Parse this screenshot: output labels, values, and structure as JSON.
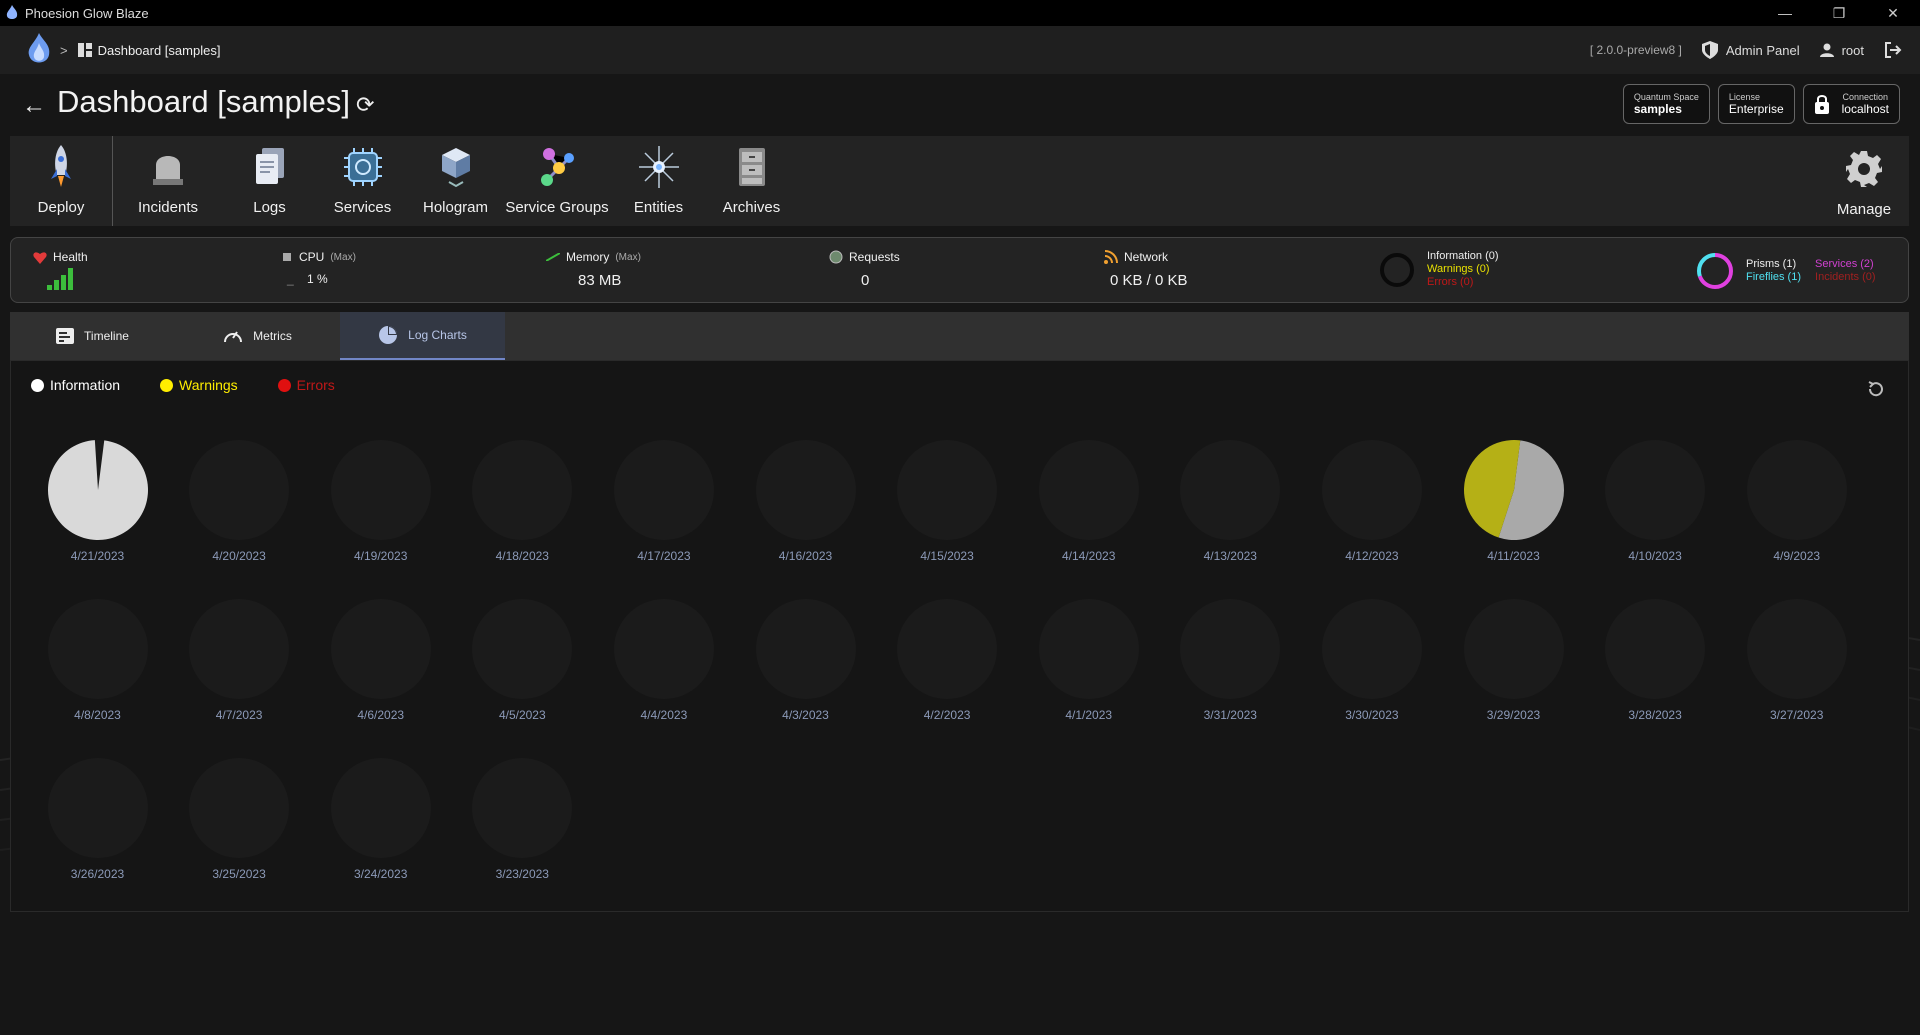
{
  "window": {
    "title": "Phoesion Glow Blaze",
    "minimize": "—",
    "restore": "❐",
    "close": "✕"
  },
  "navbar": {
    "crumb_sep": ">",
    "breadcrumb": "Dashboard [samples]",
    "version": "[ 2.0.0-preview8 ]",
    "admin_panel": "Admin Panel",
    "user": "root"
  },
  "page": {
    "title": "Dashboard [samples]",
    "back": "←",
    "refresh": "⟳",
    "chips": {
      "space_label": "Quantum Space",
      "space_value": "samples",
      "license_label": "License",
      "license_value": "Enterprise",
      "conn_label": "Connection",
      "conn_value": "localhost"
    }
  },
  "toolbar": {
    "items": [
      {
        "label": "Deploy",
        "icon": "rocket-icon"
      },
      {
        "label": "Incidents",
        "icon": "alarm-icon"
      },
      {
        "label": "Logs",
        "icon": "logs-icon"
      },
      {
        "label": "Services",
        "icon": "chip-icon"
      },
      {
        "label": "Hologram",
        "icon": "cube-icon"
      },
      {
        "label": "Service Groups",
        "icon": "molecule-icon"
      },
      {
        "label": "Entities",
        "icon": "star-icon"
      },
      {
        "label": "Archives",
        "icon": "cabinet-icon"
      }
    ],
    "manage": "Manage"
  },
  "status": {
    "health_label": "Health",
    "health_level": 1.0,
    "cpu_label": "CPU",
    "cpu_max": "(Max)",
    "cpu_value": "1 %",
    "cpu_dash": "_",
    "memory_label": "Memory",
    "memory_max": "(Max)",
    "memory_value": "83 MB",
    "requests_label": "Requests",
    "requests_value": "0",
    "network_label": "Network",
    "network_value": "0 KB / 0 KB",
    "logs": {
      "information": "Information (0)",
      "warnings": "Warnings (0)",
      "errors": "Errors (0)"
    },
    "entities": {
      "prisms": "Prisms (1)",
      "fireflies": "Fireflies (1)",
      "services": "Services (2)",
      "incidents": "Incidents (0)"
    }
  },
  "tabs": [
    {
      "label": "Timeline",
      "active": false
    },
    {
      "label": "Metrics",
      "active": false
    },
    {
      "label": "Log Charts",
      "active": true
    }
  ],
  "legend": {
    "information": "Information",
    "warnings": "Warnings",
    "errors": "Errors"
  },
  "colors": {
    "information": "#ffffff",
    "warnings": "#ffee00",
    "errors": "#e01010",
    "pie_info": "#d9d9d9",
    "pie_info_2": "#a9a9a9",
    "pie_warn": "#b5b016",
    "pie_empty": "#1b1b1b"
  },
  "chart_data": {
    "type": "pie",
    "series_keys": [
      "information",
      "warnings",
      "errors"
    ],
    "charts": [
      {
        "date": "4/21/2023",
        "information": 0.97,
        "warnings": 0,
        "errors": 0
      },
      {
        "date": "4/20/2023",
        "information": 0,
        "warnings": 0,
        "errors": 0
      },
      {
        "date": "4/19/2023",
        "information": 0,
        "warnings": 0,
        "errors": 0
      },
      {
        "date": "4/18/2023",
        "information": 0,
        "warnings": 0,
        "errors": 0
      },
      {
        "date": "4/17/2023",
        "information": 0,
        "warnings": 0,
        "errors": 0
      },
      {
        "date": "4/16/2023",
        "information": 0,
        "warnings": 0,
        "errors": 0
      },
      {
        "date": "4/15/2023",
        "information": 0,
        "warnings": 0,
        "errors": 0
      },
      {
        "date": "4/14/2023",
        "information": 0,
        "warnings": 0,
        "errors": 0
      },
      {
        "date": "4/13/2023",
        "information": 0,
        "warnings": 0,
        "errors": 0
      },
      {
        "date": "4/12/2023",
        "information": 0,
        "warnings": 0,
        "errors": 0
      },
      {
        "date": "4/11/2023",
        "information": 0.53,
        "warnings": 0.47,
        "errors": 0
      },
      {
        "date": "4/10/2023",
        "information": 0,
        "warnings": 0,
        "errors": 0
      },
      {
        "date": "4/9/2023",
        "information": 0,
        "warnings": 0,
        "errors": 0
      },
      {
        "date": "4/8/2023",
        "information": 0,
        "warnings": 0,
        "errors": 0
      },
      {
        "date": "4/7/2023",
        "information": 0,
        "warnings": 0,
        "errors": 0
      },
      {
        "date": "4/6/2023",
        "information": 0,
        "warnings": 0,
        "errors": 0
      },
      {
        "date": "4/5/2023",
        "information": 0,
        "warnings": 0,
        "errors": 0
      },
      {
        "date": "4/4/2023",
        "information": 0,
        "warnings": 0,
        "errors": 0
      },
      {
        "date": "4/3/2023",
        "information": 0,
        "warnings": 0,
        "errors": 0
      },
      {
        "date": "4/2/2023",
        "information": 0,
        "warnings": 0,
        "errors": 0
      },
      {
        "date": "4/1/2023",
        "information": 0,
        "warnings": 0,
        "errors": 0
      },
      {
        "date": "3/31/2023",
        "information": 0,
        "warnings": 0,
        "errors": 0
      },
      {
        "date": "3/30/2023",
        "information": 0,
        "warnings": 0,
        "errors": 0
      },
      {
        "date": "3/29/2023",
        "information": 0,
        "warnings": 0,
        "errors": 0
      },
      {
        "date": "3/28/2023",
        "information": 0,
        "warnings": 0,
        "errors": 0
      },
      {
        "date": "3/27/2023",
        "information": 0,
        "warnings": 0,
        "errors": 0
      },
      {
        "date": "3/26/2023",
        "information": 0,
        "warnings": 0,
        "errors": 0
      },
      {
        "date": "3/25/2023",
        "information": 0,
        "warnings": 0,
        "errors": 0
      },
      {
        "date": "3/24/2023",
        "information": 0,
        "warnings": 0,
        "errors": 0
      },
      {
        "date": "3/23/2023",
        "information": 0,
        "warnings": 0,
        "errors": 0
      }
    ]
  }
}
